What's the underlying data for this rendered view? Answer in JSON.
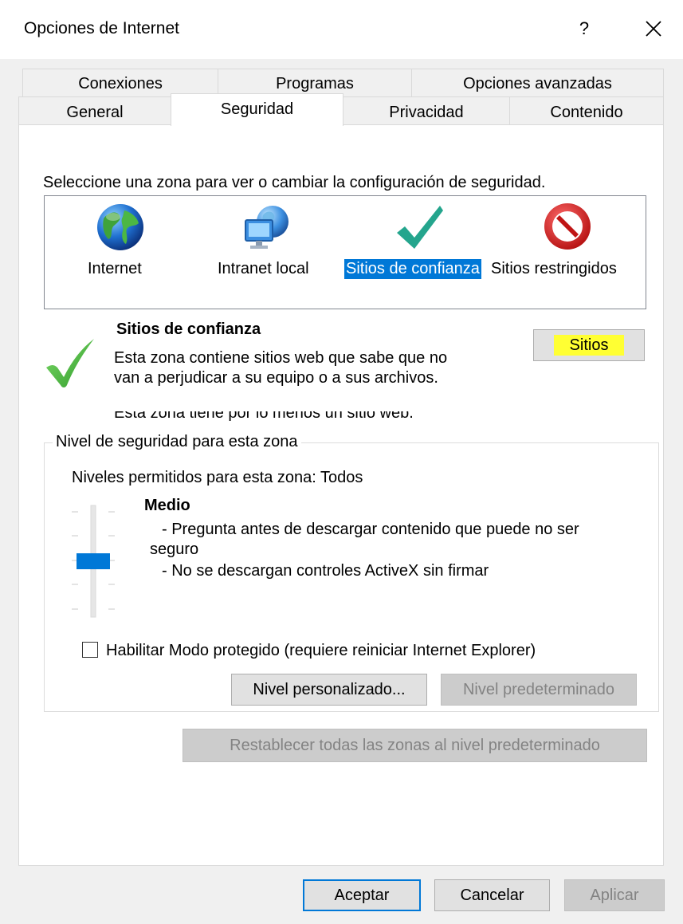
{
  "window": {
    "title": "Opciones de Internet",
    "help_glyph": "?",
    "close_glyph": "✕"
  },
  "tabs": {
    "row1": [
      "Conexiones",
      "Programas",
      "Opciones avanzadas"
    ],
    "row2": [
      "General",
      "Seguridad",
      "Privacidad",
      "Contenido"
    ],
    "selected": "Seguridad"
  },
  "zones": {
    "instruction": "Seleccione una zona para ver o cambiar la configuración de seguridad.",
    "items": [
      {
        "label": "Internet",
        "icon": "globe-icon"
      },
      {
        "label": "Intranet local",
        "icon": "intranet-icon"
      },
      {
        "label": "Sitios de confianza",
        "icon": "checkmark-icon"
      },
      {
        "label": "Sitios restringidos",
        "icon": "restricted-icon"
      }
    ],
    "selected_index": 2
  },
  "zone_info": {
    "title": "Sitios de confianza",
    "description_line1": "Esta zona contiene sitios web que sabe que no",
    "description_line2": "van a perjudicar a su equipo o a sus archivos.",
    "note": "Esta zona tiene por lo menos un sitio web.",
    "sites_button": "Sitios",
    "sites_button_highlight": "#ffff33"
  },
  "security_level": {
    "group_title": "Nivel de seguridad para esta zona",
    "allowed_levels": "Niveles permitidos para esta zona: Todos",
    "level_name": "Medio",
    "bullet1_line1": "- Pregunta antes de descargar contenido que puede no ser",
    "bullet1_line2": "seguro",
    "bullet2": "- No se descargan controles ActiveX sin firmar",
    "slider_level_fraction": 0.5,
    "protected_mode_label": "Habilitar Modo protegido (requiere reiniciar Internet Explorer)",
    "protected_mode_checked": false,
    "custom_level_button": "Nivel personalizado...",
    "default_level_button": "Nivel predeterminado"
  },
  "reset_all_button": "Restablecer todas las zonas al nivel predeterminado",
  "footer": {
    "ok": "Aceptar",
    "cancel": "Cancelar",
    "apply": "Aplicar"
  },
  "colors": {
    "accent": "#0078d7",
    "check_green": "#3cb043",
    "restricted_red": "#d81e1e"
  }
}
